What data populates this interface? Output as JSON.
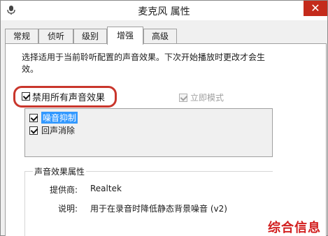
{
  "window": {
    "title": "麦克风 属性",
    "close_label": "✕"
  },
  "tabs": [
    {
      "label": "常规",
      "active": false
    },
    {
      "label": "侦听",
      "active": false
    },
    {
      "label": "级别",
      "active": false
    },
    {
      "label": "增强",
      "active": true
    },
    {
      "label": "高级",
      "active": false
    }
  ],
  "enhancements": {
    "description": "选择适用于当前聆听配置的声音效果。下次开始播放时更改才会生效。",
    "disable_all_label": "禁用所有声音效果",
    "disable_all_checked": true,
    "immediate_mode_label": "立即模式",
    "immediate_mode_checked": true,
    "immediate_mode_enabled": false,
    "effects": [
      {
        "label": "噪音抑制",
        "checked": true,
        "selected": true
      },
      {
        "label": "回声消除",
        "checked": true,
        "selected": false
      }
    ]
  },
  "properties": {
    "group_title": "声音效果属性",
    "provider_key": "提供商:",
    "provider_value": "Realtek",
    "description_key": "说明:",
    "description_value": "用于在录音时降低静态背景噪音 (v2)"
  },
  "watermark": {
    "text": "综合信息"
  },
  "colors": {
    "highlight_ring": "#c9362c",
    "close_button": "#c42b1c",
    "selection": "#3399ff",
    "watermark": "#d21f1f"
  }
}
